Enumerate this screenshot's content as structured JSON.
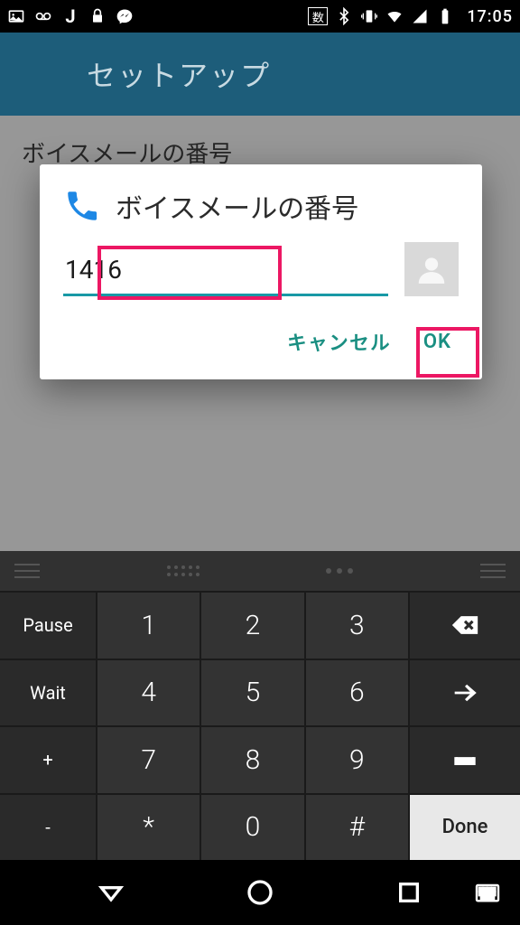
{
  "status": {
    "time": "17:05",
    "input_badge": "数"
  },
  "header": {
    "title": "セットアップ"
  },
  "settings": {
    "voicemail_label": "ボイスメールの番号"
  },
  "dialog": {
    "title": "ボイスメールの番号",
    "input_value": "1416",
    "cancel": "キャンセル",
    "ok": "OK"
  },
  "keypad": {
    "rows": [
      [
        "Pause",
        "1",
        "2",
        "3",
        "backspace"
      ],
      [
        "Wait",
        "4",
        "5",
        "6",
        "arrow"
      ],
      [
        "+",
        "7",
        "8",
        "9",
        "space"
      ],
      [
        "-",
        "*",
        "0",
        "#",
        "Done"
      ]
    ]
  }
}
